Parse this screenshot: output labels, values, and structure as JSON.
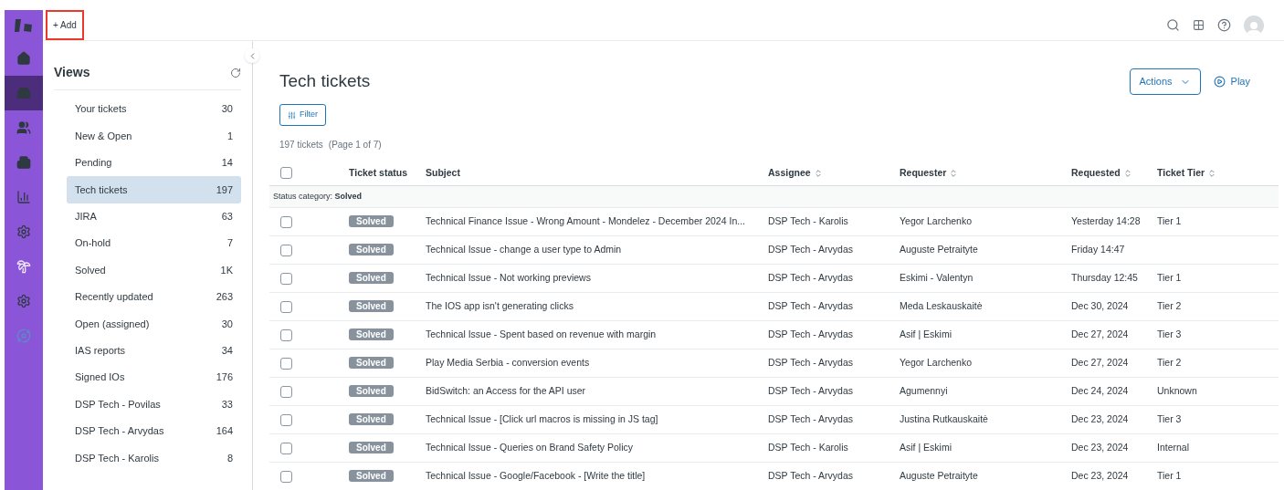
{
  "nav_items": [
    {
      "selected": false
    },
    {
      "selected": true
    },
    {
      "selected": false
    },
    {
      "selected": false
    },
    {
      "selected": false
    },
    {
      "selected": false
    },
    {
      "selected": false
    },
    {
      "selected": false
    },
    {
      "selected": false
    }
  ],
  "top_bar": {
    "add_button": "+ Add"
  },
  "views": {
    "title": "Views",
    "items": [
      {
        "label": "Your tickets",
        "count": "30",
        "selected": false
      },
      {
        "label": "New & Open",
        "count": "1",
        "selected": false
      },
      {
        "label": "Pending",
        "count": "14",
        "selected": false
      },
      {
        "label": "Tech tickets",
        "count": "197",
        "selected": true
      },
      {
        "label": "JIRA",
        "count": "63",
        "selected": false
      },
      {
        "label": "On-hold",
        "count": "7",
        "selected": false
      },
      {
        "label": "Solved",
        "count": "1K",
        "selected": false
      },
      {
        "label": "Recently updated",
        "count": "263",
        "selected": false
      },
      {
        "label": "Open (assigned)",
        "count": "30",
        "selected": false
      },
      {
        "label": "IAS reports",
        "count": "34",
        "selected": false
      },
      {
        "label": "Signed IOs",
        "count": "176",
        "selected": false
      },
      {
        "label": "DSP Tech - Povilas",
        "count": "33",
        "selected": false
      },
      {
        "label": "DSP Tech - Arvydas",
        "count": "164",
        "selected": false
      },
      {
        "label": "DSP Tech - Karolis",
        "count": "8",
        "selected": false
      }
    ]
  },
  "main": {
    "title": "Tech tickets",
    "actions_button": "Actions",
    "play_button": "Play",
    "filter_button": "Filter",
    "ticket_count": "197 tickets",
    "page_info": "(Page 1 of 7)"
  },
  "table": {
    "select_all_checked": false,
    "columns": [
      {
        "label": "Ticket status",
        "sortable": false
      },
      {
        "label": "Subject",
        "sortable": false
      },
      {
        "label": "Assignee",
        "sortable": true
      },
      {
        "label": "Requester",
        "sortable": true
      },
      {
        "label": "Requested",
        "sortable": true
      },
      {
        "label": "Ticket Tier",
        "sortable": true
      }
    ],
    "group_label": "Status category: **Solved**",
    "rows": [
      {
        "checked": false,
        "status": "Solved",
        "subject": "Technical Finance Issue - Wrong Amount - Mondelez - December 2024 In...",
        "assignee": "DSP Tech - Karolis",
        "requester": "Yegor Larchenko",
        "requested": "Yesterday 14:28",
        "tier": "Tier 1"
      },
      {
        "checked": false,
        "status": "Solved",
        "subject": "Technical Issue - change a user type to Admin",
        "assignee": "DSP Tech - Arvydas",
        "requester": "Auguste Petraityte",
        "requested": "Friday 14:47"
      },
      {
        "checked": false,
        "status": "Solved",
        "subject": "Technical Issue - Not working previews",
        "assignee": "DSP Tech - Arvydas",
        "requester": "Eskimi - Valentyn",
        "requested": "Thursday 12:45",
        "tier": "Tier 1"
      },
      {
        "checked": false,
        "status": "Solved",
        "subject": "The IOS app isn't generating clicks",
        "assignee": "DSP Tech - Arvydas",
        "requester": "Meda Leskauskaitė",
        "requested": "Dec 30, 2024",
        "tier": "Tier 2"
      },
      {
        "checked": false,
        "status": "Solved",
        "subject": "Technical Issue - Spent based on revenue with margin",
        "assignee": "DSP Tech - Arvydas",
        "requester": "Asif | Eskimi",
        "requested": "Dec 27, 2024",
        "tier": "Tier 3"
      },
      {
        "checked": false,
        "status": "Solved",
        "subject": "Play Media Serbia - conversion events",
        "assignee": "DSP Tech - Arvydas",
        "requester": "Yegor Larchenko",
        "requested": "Dec 27, 2024",
        "tier": "Tier 2"
      },
      {
        "checked": false,
        "status": "Solved",
        "subject": "BidSwitch: an Access for the API user",
        "assignee": "DSP Tech - Arvydas",
        "requester": "Agumennyi",
        "requested": "Dec 24, 2024",
        "tier": "Unknown"
      },
      {
        "checked": false,
        "status": "Solved",
        "subject": "Technical Issue - [Click url macros is missing in JS tag]",
        "assignee": "DSP Tech - Arvydas",
        "requester": "Justina Rutkauskaitė",
        "requested": "Dec 23, 2024",
        "tier": "Tier 3"
      },
      {
        "checked": false,
        "status": "Solved",
        "subject": "Technical Issue - Queries on Brand Safety Policy",
        "assignee": "DSP Tech - Karolis",
        "requester": "Asif | Eskimi",
        "requested": "Dec 23, 2024",
        "tier": "Internal"
      },
      {
        "checked": false,
        "status": "Solved",
        "subject": "Technical Issue - Google/Facebook - [Write the title]",
        "assignee": "DSP Tech - Arvydas",
        "requester": "Auguste Petraityte",
        "requested": "Dec 23, 2024",
        "tier": "Tier 1"
      }
    ]
  }
}
